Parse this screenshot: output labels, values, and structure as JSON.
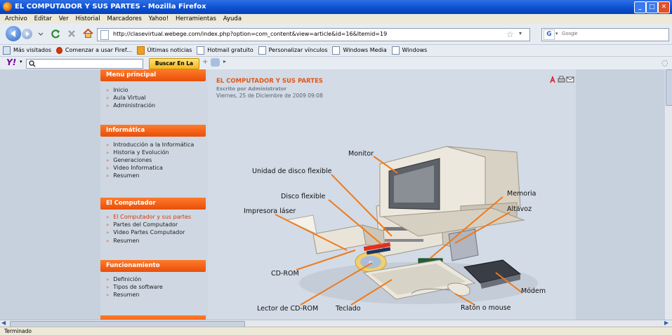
{
  "window": {
    "title": "EL COMPUTADOR Y SUS PARTES - Mozilla Firefox",
    "controls": [
      "_",
      "□",
      "✕"
    ]
  },
  "menubar": [
    "Archivo",
    "Editar",
    "Ver",
    "Historial",
    "Marcadores",
    "Yahoo!",
    "Herramientas",
    "Ayuda"
  ],
  "nav": {
    "url": "http://clasevirtual.webege.com/index.php?option=com_content&view=article&id=16&Itemid=19",
    "search_placeholder": "Google"
  },
  "bookmarks": [
    "Más visitados",
    "Comenzar a usar Firef...",
    "Últimas noticias",
    "Hotmail gratuito",
    "Personalizar vínculos",
    "Windows Media",
    "Windows"
  ],
  "yahoo": {
    "logo": "Y!",
    "button": "Buscar En La Web"
  },
  "menus": [
    {
      "title": "Menú principal",
      "items": [
        "Inicio",
        "Aula Virtual",
        "Administración"
      ]
    },
    {
      "title": "Informática",
      "items": [
        "Introducción a la Informática",
        "Historia y Evolución",
        "Generaciones",
        "Video Informatica",
        "Resumen"
      ]
    },
    {
      "title": "El Computador",
      "items": [
        "El Computador y sus partes",
        "Partes del Computador",
        "Video Partes Computador",
        "Resumen"
      ]
    },
    {
      "title": "Funcionamiento",
      "items": [
        "Definición",
        "Tipos de software",
        "Resumen"
      ]
    }
  ],
  "article": {
    "title": "EL COMPUTADOR Y SUS PARTES",
    "author": "Escrito por Administrator",
    "date": "Viernes, 25 de Diciembre de 2009 09:08"
  },
  "diagram_labels": {
    "monitor": "Monitor",
    "floppy_drive": "Unidad de disco flexible",
    "floppy_disk": "Disco flexible",
    "printer": "Impresora láser",
    "cdrom": "CD-ROM",
    "cd_reader": "Lector de CD-ROM",
    "keyboard": "Teclado",
    "mouse": "Ratón o mouse",
    "memory": "Memoria",
    "speaker": "Altavoz",
    "modem": "Módem"
  },
  "status": "Terminado",
  "colors": {
    "accent": "#e84f0a",
    "title_bar": "#0a4fcf",
    "leader_lines": "#f07a1a"
  }
}
